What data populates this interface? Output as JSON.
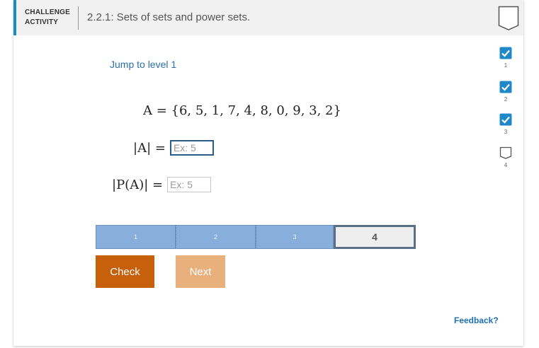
{
  "header": {
    "label_line1": "CHALLENGE",
    "label_line2": "ACTIVITY",
    "title": "2.2.1: Sets of sets and power sets."
  },
  "jump_link": "Jump to level 1",
  "set_expression": "A = {6, 5, 1, 7, 4, 8, 0, 9, 3, 2}",
  "questions": [
    {
      "expr": "|A| =",
      "placeholder": "Ex: 5"
    },
    {
      "expr": "|P(A)| =",
      "placeholder": "Ex: 5"
    }
  ],
  "progress": {
    "segments": [
      "1",
      "2",
      "3",
      "4"
    ],
    "current": "4"
  },
  "buttons": {
    "check": "Check",
    "next": "Next"
  },
  "feedback": "Feedback?",
  "levels": [
    {
      "num": "1",
      "state": "completed"
    },
    {
      "num": "2",
      "state": "completed"
    },
    {
      "num": "3",
      "state": "completed"
    },
    {
      "num": "4",
      "state": "current"
    }
  ],
  "colors": {
    "accent_blue": "#1e88c8",
    "check_orange": "#c7600a",
    "next_orange": "#e8b07c",
    "progress_done": "#88aedb",
    "level_check": "#1e88c8"
  }
}
